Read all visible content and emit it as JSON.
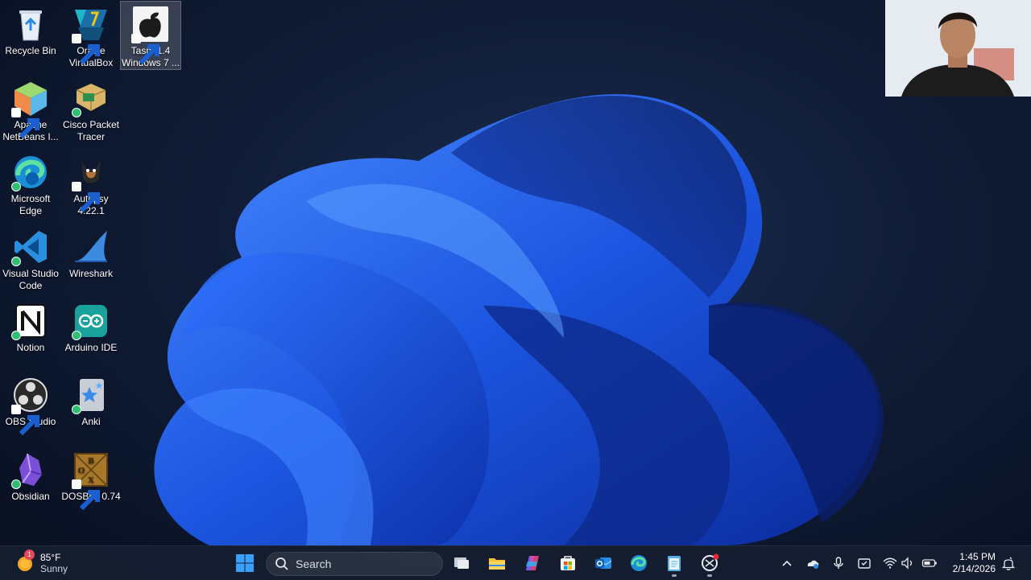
{
  "desktop": {
    "icons": [
      {
        "label": "Recycle Bin"
      },
      {
        "label": "Oracle VirtualBox"
      },
      {
        "label": "Tasm 1.4 Windows 7 ..."
      },
      {
        "label": "Apache NetBeans I..."
      },
      {
        "label": "Cisco Packet Tracer"
      },
      {
        "label": "Microsoft Edge"
      },
      {
        "label": "Autopsy 4.22.1"
      },
      {
        "label": "Visual Studio Code"
      },
      {
        "label": "Wireshark"
      },
      {
        "label": "Notion"
      },
      {
        "label": "Arduino IDE"
      },
      {
        "label": "OBS Studio"
      },
      {
        "label": "Anki"
      },
      {
        "label": "Obsidian"
      },
      {
        "label": "DOSBox 0.74"
      }
    ],
    "icon_art": {
      "dosbox_letters": "BOX"
    }
  },
  "taskbar": {
    "weather": {
      "temp": "85°F",
      "condition": "Sunny",
      "badge": "1"
    },
    "search_placeholder": "Search",
    "pinned": [
      "start-icon",
      "task-view-icon",
      "file-explorer-icon",
      "copilot-icon",
      "microsoft-store-icon",
      "outlook-icon",
      "edge-icon",
      "notepad-icon",
      "snipping-tool-icon"
    ],
    "clock": {
      "time": "1:45 PM",
      "date": "2/14/2026"
    }
  },
  "colors": {
    "accent": "#2b6ee8",
    "taskbar": "#161e30",
    "wallpaper": "#0b1428"
  }
}
